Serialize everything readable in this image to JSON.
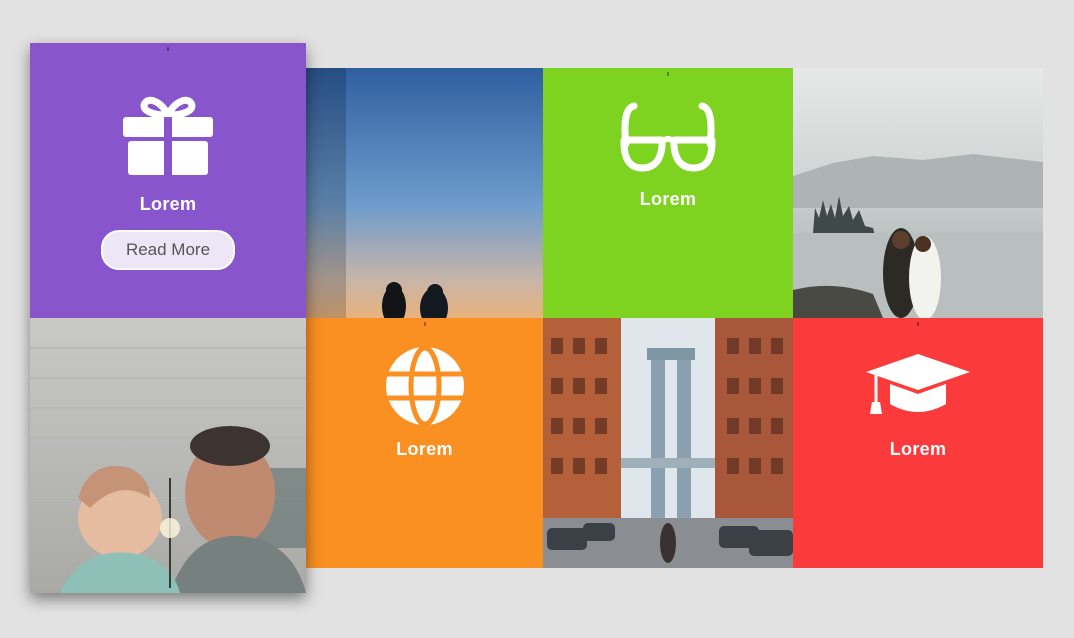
{
  "colors": {
    "background": "#e2e2e2",
    "purple": "#8855cc",
    "green": "#7ed321",
    "orange": "#fa8f22",
    "red": "#fb3b3b"
  },
  "featured": {
    "label": "Lorem",
    "icon": "gift-icon",
    "button_label": "Read More"
  },
  "tiles": [
    {
      "label": "Lorem",
      "icon": "glasses-icon"
    },
    {
      "label": "Lorem",
      "icon": "globe-icon"
    },
    {
      "label": "Lorem",
      "icon": "graduation-cap-icon"
    }
  ]
}
